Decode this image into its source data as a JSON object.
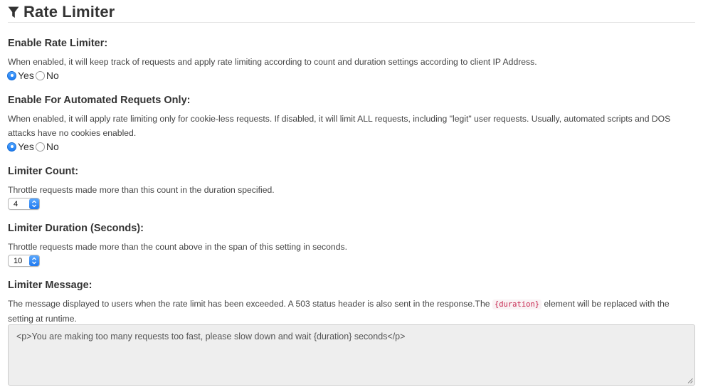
{
  "header": {
    "title": "Rate Limiter",
    "icon": "filter-funnel-icon"
  },
  "settings": {
    "enable": {
      "label": "Enable Rate Limiter:",
      "help": "When enabled, it will keep track of requests and apply rate limiting according to count and duration settings according to client IP Address.",
      "yes_label": "Yes",
      "no_label": "No",
      "selected": "Yes"
    },
    "automated": {
      "label": "Enable For Automated Requets Only:",
      "help": "When enabled, it will apply rate limiting only for cookie-less requests. If disabled, it will limit ALL requests, including \"legit\" user requests. Usually, automated scripts and DOS attacks have no cookies enabled.",
      "yes_label": "Yes",
      "no_label": "No",
      "selected": "Yes"
    },
    "count": {
      "label": "Limiter Count:",
      "help": "Throttle requests made more than this count in the duration specified.",
      "value": "4"
    },
    "duration": {
      "label": "Limiter Duration (Seconds):",
      "help": "Throttle requests made more than the count above in the span of this setting in seconds.",
      "value": "10"
    },
    "message": {
      "label": "Limiter Message:",
      "help_before": "The message displayed to users when the rate limit has been exceeded. A 503 status header is also sent in the response.The",
      "help_code": "{duration}",
      "help_after": "element will be replaced with the setting at runtime.",
      "value": "<p>You are making too many requests too fast, please slow down and wait {duration} seconds</p>"
    }
  },
  "colors": {
    "accent": "#1d7cf2",
    "code_text": "#c7254e",
    "code_bg": "#f9f2f4"
  }
}
